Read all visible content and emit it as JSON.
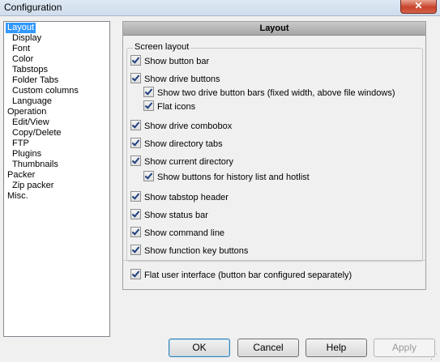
{
  "window": {
    "title": "Configuration",
    "close_glyph": "✕"
  },
  "tree": {
    "items": [
      {
        "label": "Layout",
        "selected": true
      },
      {
        "label": "Display"
      },
      {
        "label": "Font"
      },
      {
        "label": "Color"
      },
      {
        "label": "Tabstops"
      },
      {
        "label": "Folder Tabs"
      },
      {
        "label": "Custom columns"
      },
      {
        "label": "Language"
      },
      {
        "label": "Operation"
      },
      {
        "label": "Edit/View"
      },
      {
        "label": "Copy/Delete"
      },
      {
        "label": "FTP"
      },
      {
        "label": "Plugins"
      },
      {
        "label": "Thumbnails"
      },
      {
        "label": "Packer"
      },
      {
        "label": "Zip packer"
      },
      {
        "label": "Misc."
      }
    ]
  },
  "panel": {
    "header": "Layout",
    "group_title": "Screen layout",
    "options": [
      {
        "label": "Show button bar",
        "checked": true
      },
      {
        "label": "Show drive buttons",
        "checked": true
      },
      {
        "label": "Show two drive button bars (fixed width, above file windows)",
        "checked": true
      },
      {
        "label": "Flat icons",
        "checked": true
      },
      {
        "label": "Show drive combobox",
        "checked": true
      },
      {
        "label": "Show directory tabs",
        "checked": true
      },
      {
        "label": "Show current directory",
        "checked": true
      },
      {
        "label": "Show buttons for history list and hotlist",
        "checked": true
      },
      {
        "label": "Show tabstop header",
        "checked": true
      },
      {
        "label": "Show status bar",
        "checked": true
      },
      {
        "label": "Show command line",
        "checked": true
      },
      {
        "label": "Show function key buttons",
        "checked": true
      }
    ],
    "flat_ui": {
      "label": "Flat user interface (button bar configured separately)",
      "checked": true
    }
  },
  "buttons": {
    "ok": "OK",
    "cancel": "Cancel",
    "help": "Help",
    "apply": "Apply"
  },
  "colors": {
    "selection": "#3399ff",
    "header_bg": "#b4b4b4",
    "checkmark": "#1f3f7f"
  }
}
